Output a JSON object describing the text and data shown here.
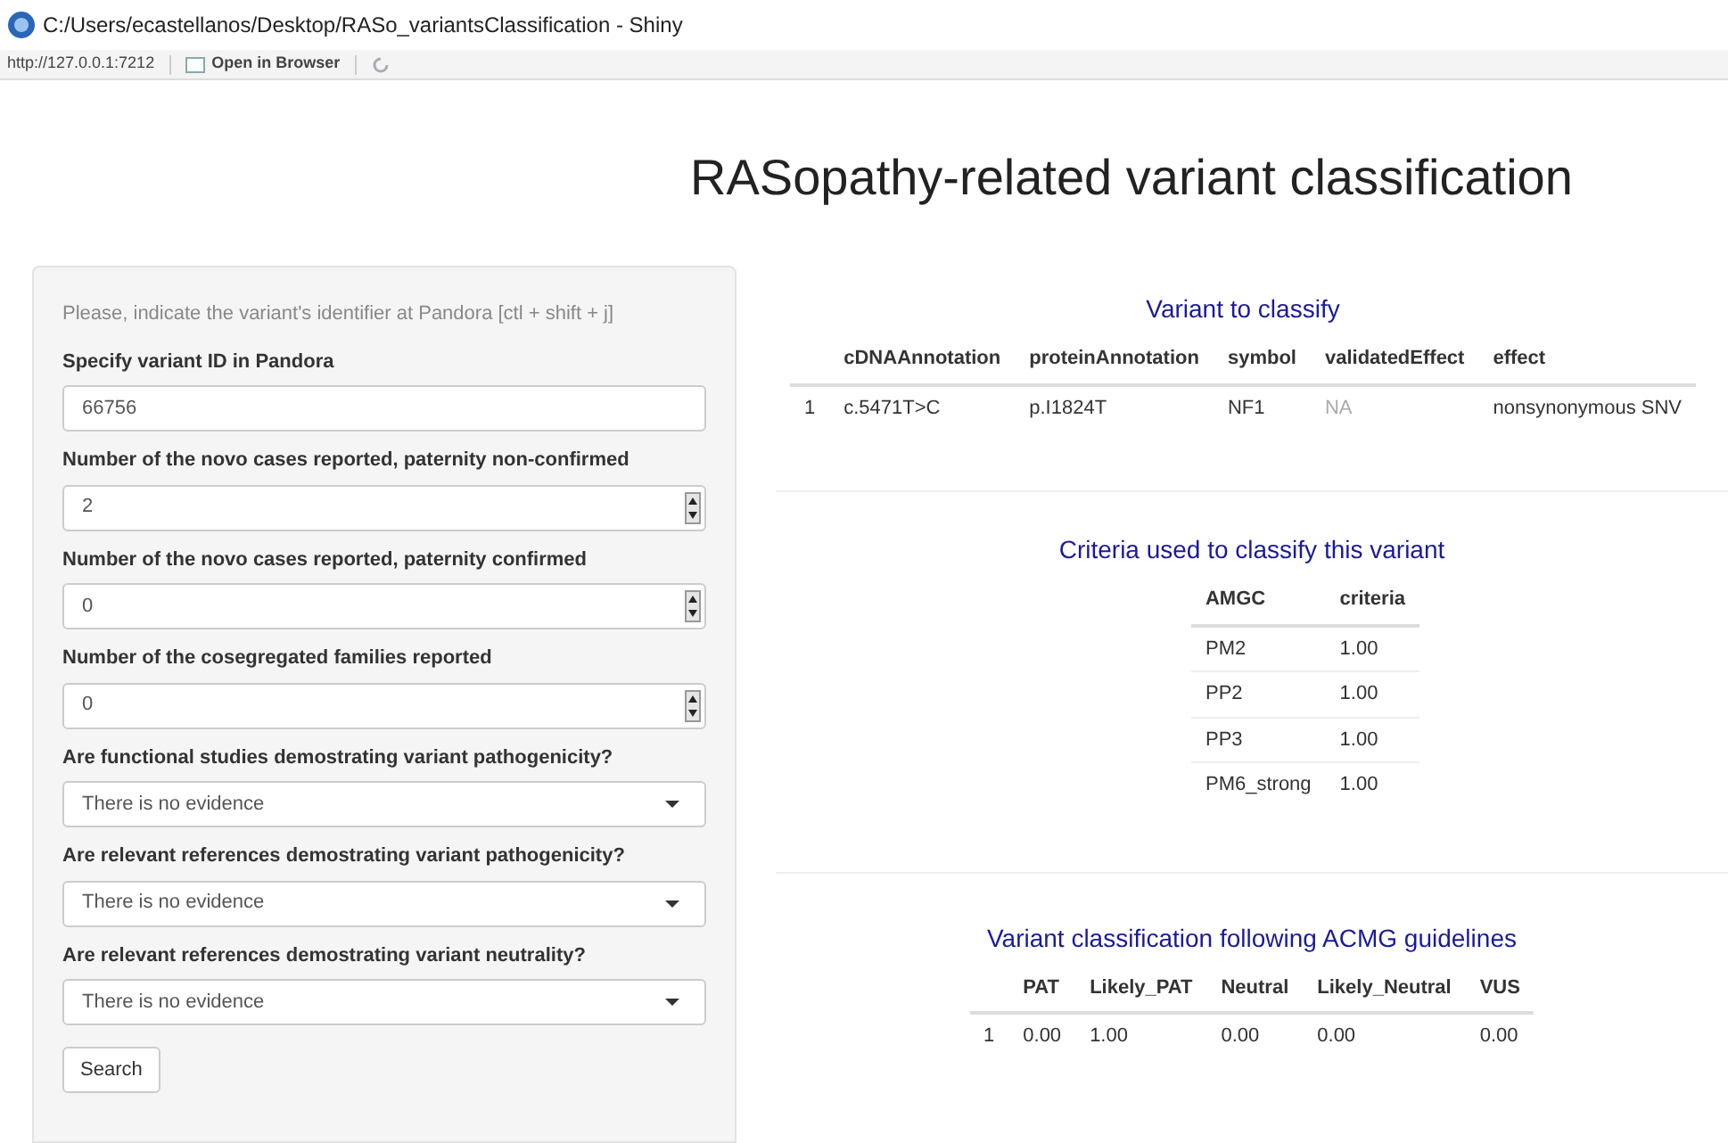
{
  "window": {
    "title": "C:/Users/ecastellanos/Desktop/RASo_variantsClassification - Shiny"
  },
  "toolbar": {
    "url": "http://127.0.0.1:7212",
    "open_button": "Open in Browser"
  },
  "page_title": "RASopathy-related variant classification",
  "form": {
    "hint": "Please, indicate the variant's identifier at Pandora [ctl + shift + j]",
    "fields": [
      {
        "kind": "text",
        "label": "Specify variant ID in Pandora",
        "value": "66756"
      },
      {
        "kind": "number",
        "label": "Number of the novo cases reported, paternity non-confirmed",
        "value": "2"
      },
      {
        "kind": "number",
        "label": "Number of the novo cases reported, paternity confirmed",
        "value": "0"
      },
      {
        "kind": "number",
        "label": "Number of the cosegregated families reported",
        "value": "0"
      },
      {
        "kind": "select",
        "label": "Are functional studies demostrating variant pathogenicity?",
        "value": "There is no evidence"
      },
      {
        "kind": "select",
        "label": "Are relevant references demostrating variant pathogenicity?",
        "value": "There is no evidence"
      },
      {
        "kind": "select",
        "label": "Are relevant references demostrating variant neutrality?",
        "value": "There is no evidence"
      }
    ],
    "button": "Search"
  },
  "sections": [
    {
      "title": "Variant to classify",
      "columns": [
        "cDNAAnnotation",
        "proteinAnnotation",
        "symbol",
        "validatedEffect",
        "effect"
      ],
      "rows": [
        {
          "number": "1",
          "cells": [
            {
              "text": "c.5471T>C",
              "muted": false
            },
            {
              "text": "p.I1824T",
              "muted": false
            },
            {
              "text": "NF1",
              "muted": false
            },
            {
              "text": "NA",
              "muted": true
            },
            {
              "text": "nonsynonymous SNV",
              "muted": false
            }
          ]
        }
      ]
    },
    {
      "title": "Criteria used to classify this variant",
      "columns": [
        "AMGC",
        "criteria"
      ],
      "rows": [
        {
          "cells": [
            {
              "text": "PM2",
              "muted": false
            },
            {
              "text": "1.00",
              "muted": false
            }
          ]
        },
        {
          "cells": [
            {
              "text": "PP2",
              "muted": false
            },
            {
              "text": "1.00",
              "muted": false
            }
          ]
        },
        {
          "cells": [
            {
              "text": "PP3",
              "muted": false
            },
            {
              "text": "1.00",
              "muted": false
            }
          ]
        },
        {
          "cells": [
            {
              "text": "PM6_strong",
              "muted": false
            },
            {
              "text": "1.00",
              "muted": false
            }
          ]
        }
      ]
    },
    {
      "title": "Variant classification following ACMG guidelines",
      "columns": [
        "PAT",
        "Likely_PAT",
        "Neutral",
        "Likely_Neutral",
        "VUS"
      ],
      "rows": [
        {
          "number": "1",
          "cells": [
            {
              "text": "0.00",
              "muted": false
            },
            {
              "text": "1.00",
              "muted": false
            },
            {
              "text": "0.00",
              "muted": false
            },
            {
              "text": "0.00",
              "muted": false
            },
            {
              "text": "0.00",
              "muted": false
            }
          ]
        }
      ]
    }
  ]
}
